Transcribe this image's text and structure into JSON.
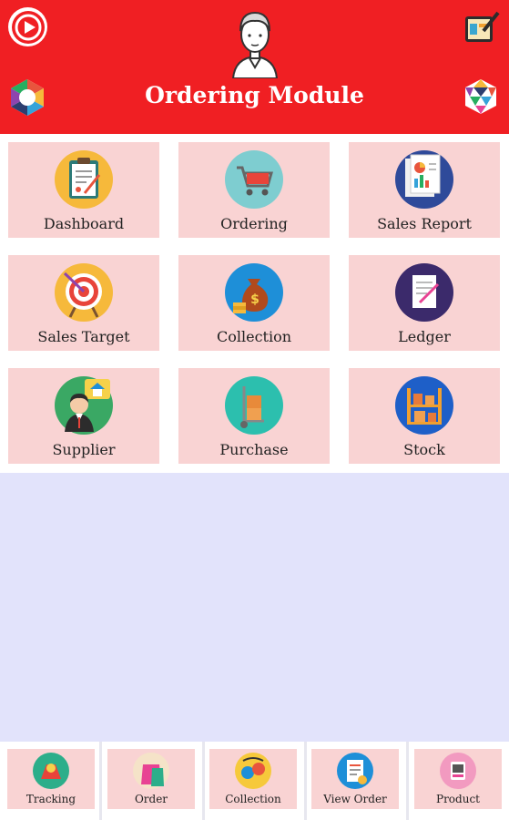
{
  "header": {
    "title": "Ordering Module",
    "bg_color": "#f01f23",
    "play_icon": "play-icon",
    "edit_icon": "edit-icon",
    "left_icon": "hexagon-ring-icon",
    "right_icon": "hexagon-segments-icon",
    "avatar_icon": "user-avatar-icon"
  },
  "grid": {
    "tiles": [
      {
        "label": "Dashboard",
        "icon": "clipboard-icon"
      },
      {
        "label": "Ordering",
        "icon": "shopping-cart-icon"
      },
      {
        "label": "Sales Report",
        "icon": "report-chart-icon"
      },
      {
        "label": "Sales Target",
        "icon": "target-icon"
      },
      {
        "label": "Collection",
        "icon": "money-bag-icon"
      },
      {
        "label": "Ledger",
        "icon": "ledger-document-icon"
      },
      {
        "label": "Supplier",
        "icon": "supplier-person-icon"
      },
      {
        "label": "Purchase",
        "icon": "hand-truck-icon"
      },
      {
        "label": "Stock",
        "icon": "stock-shelf-icon"
      }
    ]
  },
  "bottom_nav": {
    "items": [
      {
        "label": "Tracking",
        "icon": "map-pin-icon"
      },
      {
        "label": "Order",
        "icon": "shopping-bag-icon"
      },
      {
        "label": "Collection",
        "icon": "coin-exchange-icon"
      },
      {
        "label": "View Order",
        "icon": "order-list-icon"
      },
      {
        "label": "Product",
        "icon": "product-box-icon"
      }
    ]
  },
  "colors": {
    "accent": "#f01f23",
    "tile_bg": "#f9d3d3",
    "page_bg": "#e2e3fb"
  }
}
